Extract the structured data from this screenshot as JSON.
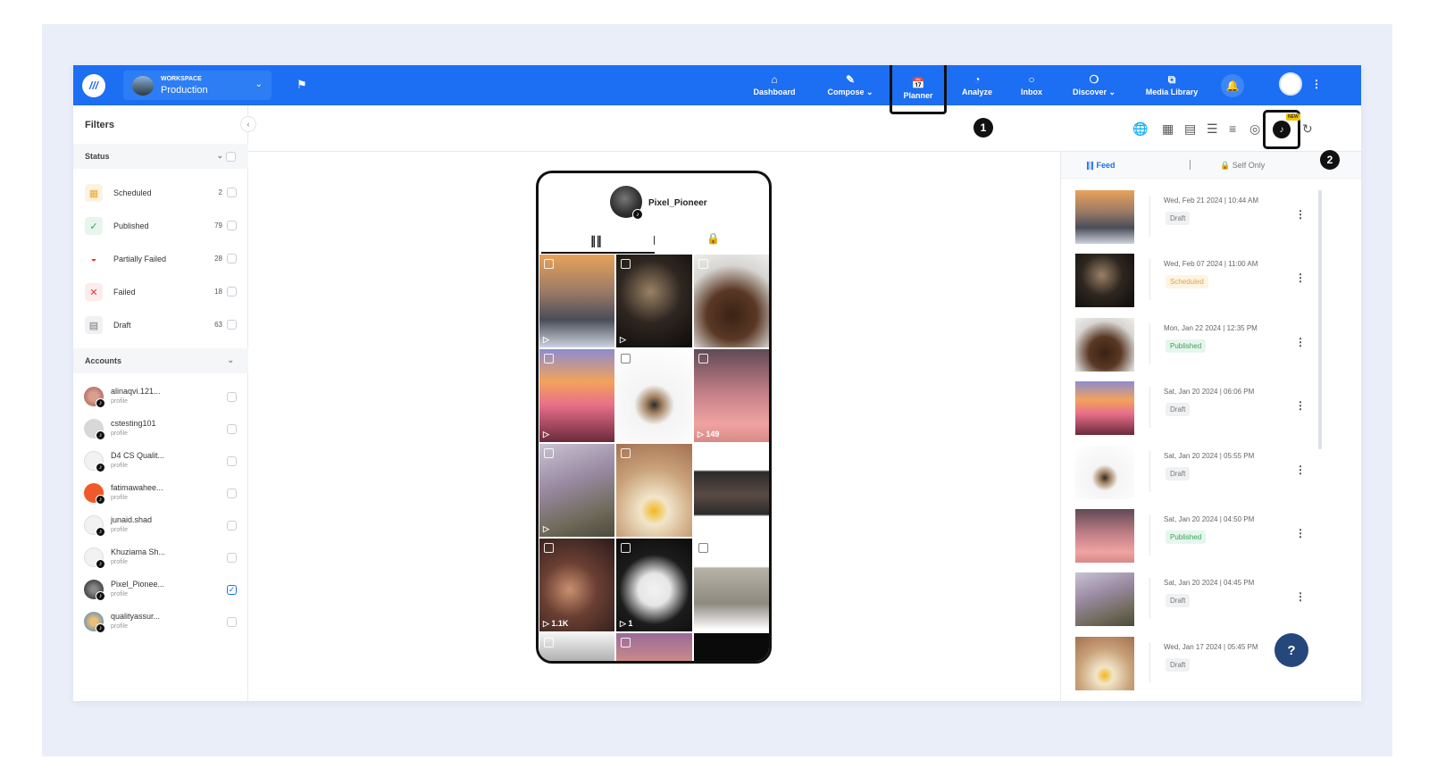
{
  "topbar": {
    "workspace_label": "WORKSPACE",
    "workspace_name": "Production",
    "nav": [
      {
        "label": "Dashboard",
        "icon": "home-icon"
      },
      {
        "label": "Compose",
        "icon": "pen-icon"
      },
      {
        "label": "Planner",
        "icon": "calendar-icon"
      },
      {
        "label": "Analyze",
        "icon": "chart-icon"
      },
      {
        "label": "Inbox",
        "icon": "chat-icon"
      },
      {
        "label": "Discover",
        "icon": "compass-icon"
      },
      {
        "label": "Media Library",
        "icon": "media-icon"
      }
    ],
    "active_nav": "Planner"
  },
  "markers": {
    "one": "1",
    "two": "2"
  },
  "sidebar": {
    "title": "Filters",
    "status_header": "Status",
    "statuses": [
      {
        "label": "Scheduled",
        "count": "2",
        "color": "#f5a623"
      },
      {
        "label": "Published",
        "count": "79",
        "color": "#37a35b"
      },
      {
        "label": "Partially Failed",
        "count": "28",
        "color": "#e53935"
      },
      {
        "label": "Failed",
        "count": "18",
        "color": "#e53935"
      },
      {
        "label": "Draft",
        "count": "63",
        "color": "#777777"
      }
    ],
    "accounts_header": "Accounts",
    "accounts": [
      {
        "name": "alinaqvi.121...",
        "sub": "profile",
        "checked": false
      },
      {
        "name": "cstesting101",
        "sub": "profile",
        "checked": false
      },
      {
        "name": "D4 CS Qualit...",
        "sub": "profile",
        "checked": false
      },
      {
        "name": "fatimawahee...",
        "sub": "profile",
        "checked": false
      },
      {
        "name": "junaid.shad",
        "sub": "profile",
        "checked": false
      },
      {
        "name": "Khuziama Sh...",
        "sub": "profile",
        "checked": false
      },
      {
        "name": "Pixel_Pionee...",
        "sub": "profile",
        "checked": true
      },
      {
        "name": "qualityassur...",
        "sub": "profile",
        "checked": false
      }
    ]
  },
  "toolbar": {
    "new_badge": "NEW"
  },
  "phone": {
    "username": "Pixel_Pioneer",
    "cells": [
      {
        "caption": ""
      },
      {
        "caption": ""
      },
      {
        "caption": ""
      },
      {
        "caption": ""
      },
      {
        "caption": ""
      },
      {
        "caption": "149"
      },
      {
        "caption": ""
      },
      {
        "caption": ""
      },
      {
        "caption": ""
      },
      {
        "caption": "1.1K"
      },
      {
        "caption": "1"
      },
      {
        "caption": ""
      },
      {
        "caption": ""
      },
      {
        "caption": ""
      },
      {
        "caption": ""
      }
    ]
  },
  "feed": {
    "tab_feed": "Feed",
    "tab_self": "Self Only",
    "items": [
      {
        "date": "Wed, Feb 21 2024 | 10:44 AM",
        "status": "Draft"
      },
      {
        "date": "Wed, Feb 07 2024 | 11:00 AM",
        "status": "Scheduled"
      },
      {
        "date": "Mon, Jan 22 2024 | 12:35 PM",
        "status": "Published"
      },
      {
        "date": "Sat, Jan 20 2024 | 06:06 PM",
        "status": "Draft"
      },
      {
        "date": "Sat, Jan 20 2024 | 05:55 PM",
        "status": "Draft"
      },
      {
        "date": "Sat, Jan 20 2024 | 04:50 PM",
        "status": "Published"
      },
      {
        "date": "Sat, Jan 20 2024 | 04:45 PM",
        "status": "Draft"
      },
      {
        "date": "Wed, Jan 17 2024 | 05:45 PM",
        "status": "Draft"
      }
    ]
  },
  "help": {
    "label": "?"
  }
}
